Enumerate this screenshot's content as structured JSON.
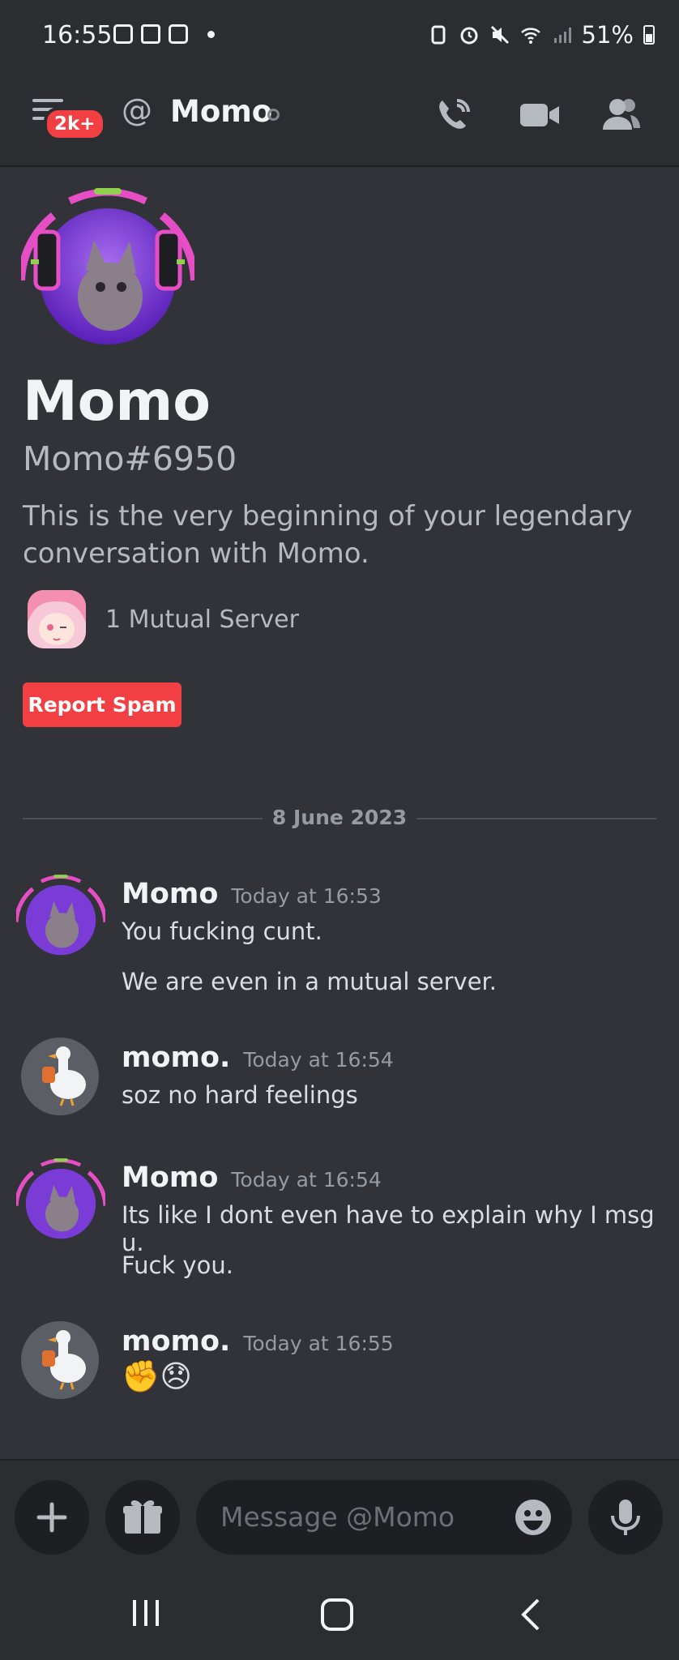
{
  "status_bar": {
    "time": "16:55",
    "battery": "51%"
  },
  "header": {
    "badge": "2k+",
    "channel_name": "Momo",
    "icons": [
      "menu-icon",
      "at-icon",
      "call-icon",
      "video-icon",
      "members-icon"
    ]
  },
  "intro": {
    "name": "Momo",
    "tag": "Momo#6950",
    "text": "This is the very beginning of your legendary conversation with Momo.",
    "mutual": "1 Mutual Server",
    "report_button": "Report Spam"
  },
  "date_divider": "8 June 2023",
  "messages": [
    {
      "author": "Momo",
      "time": "Today at 16:53",
      "lines": [
        "You fucking cunt.",
        "We are even in a mutual server."
      ]
    },
    {
      "author": "momo.",
      "time": "Today at 16:54",
      "lines": [
        "soz no hard feelings"
      ]
    },
    {
      "author": "Momo",
      "time": "Today at 16:54",
      "lines": [
        "Its like I dont even have to explain why I msg u.",
        "Fuck you."
      ]
    },
    {
      "author": "momo.",
      "time": "Today at 16:55",
      "lines": [
        "✊😞"
      ]
    }
  ],
  "composer": {
    "placeholder": "Message @Momo"
  },
  "colors": {
    "background": "#313338",
    "header": "#2b2d31",
    "danger": "#f23f43",
    "text_muted": "#949ba4"
  }
}
